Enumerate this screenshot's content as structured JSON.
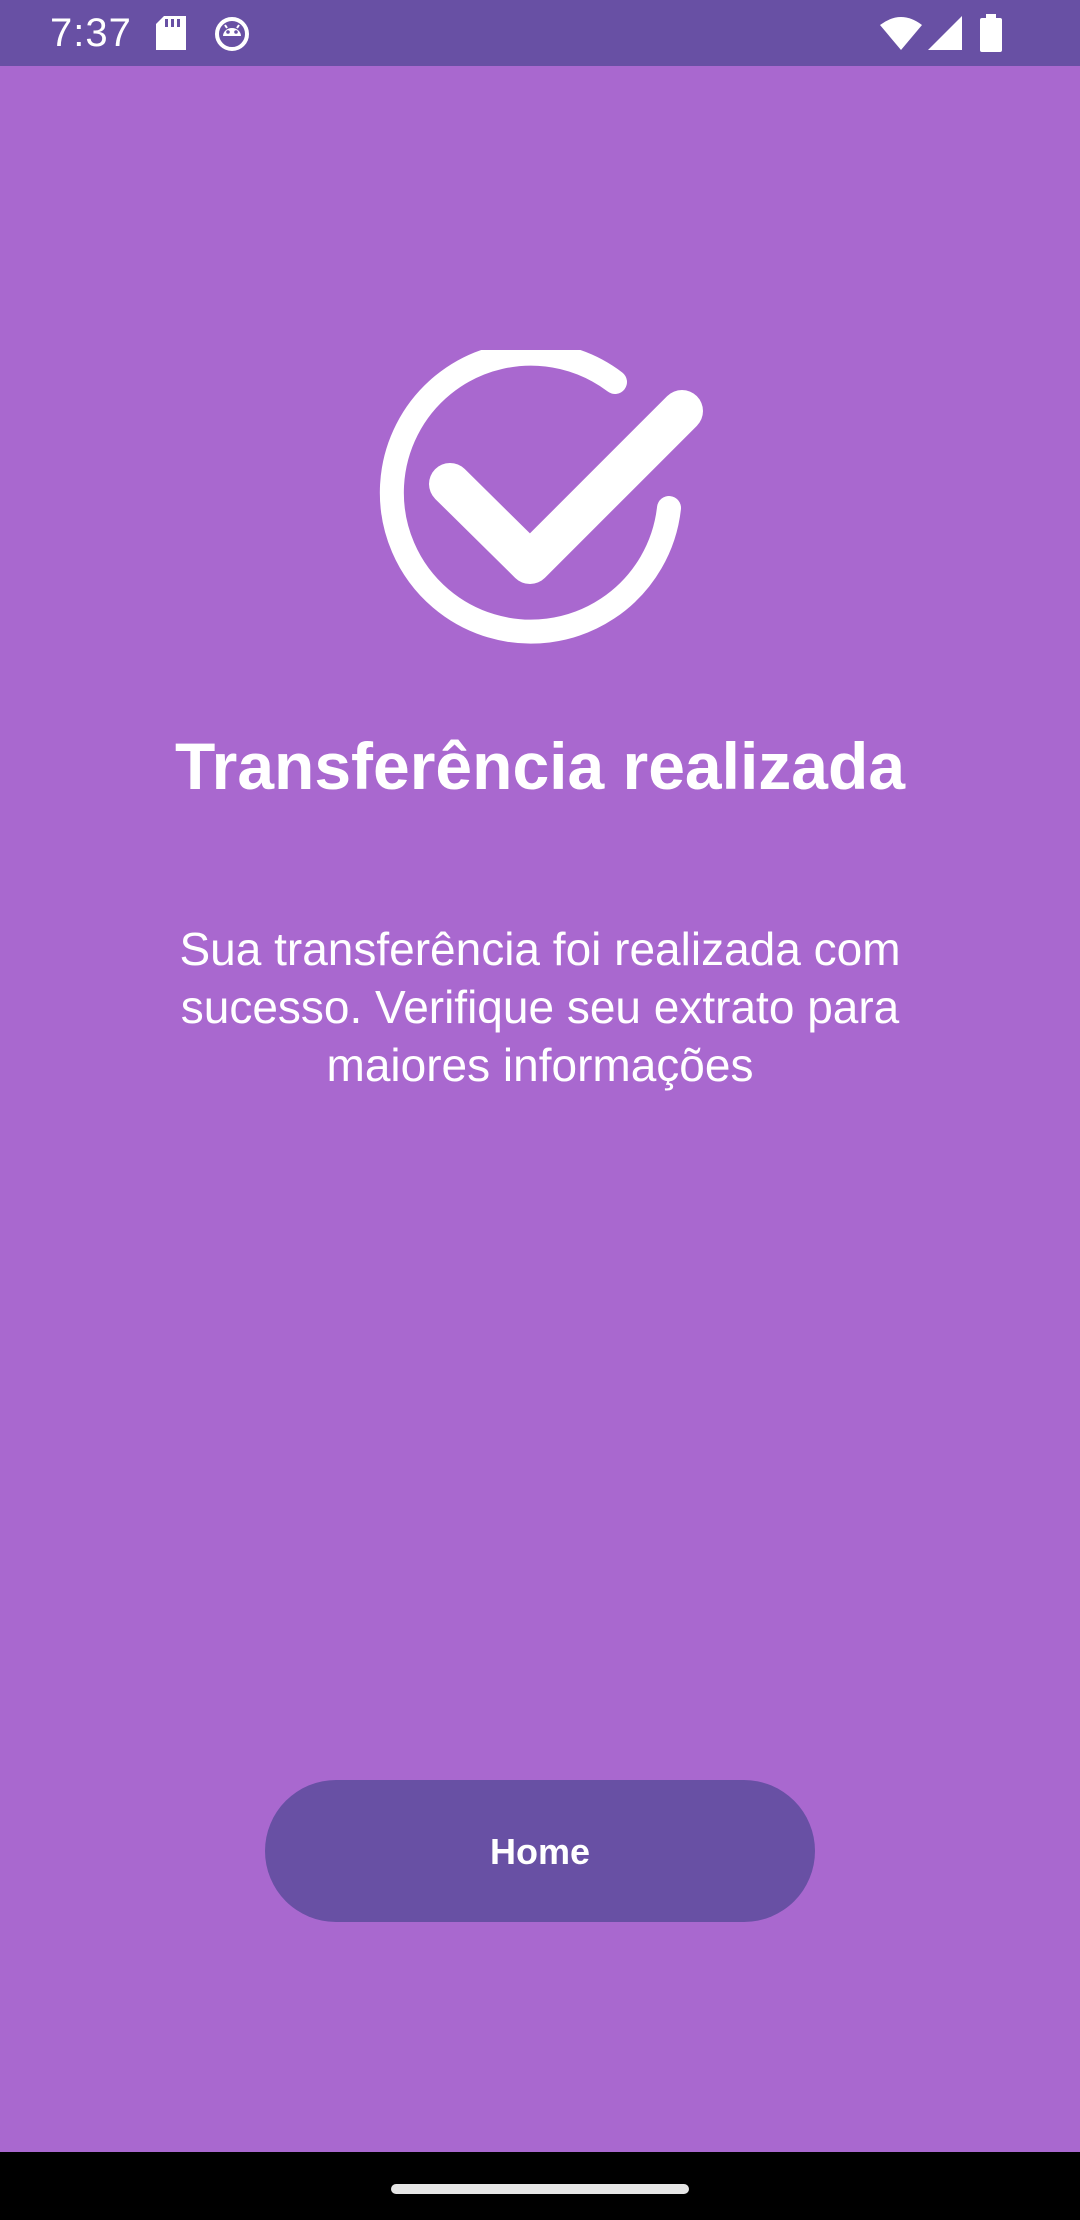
{
  "status_bar": {
    "time": "7:37",
    "left_icons": [
      "sd-card-icon",
      "android-debug-icon"
    ],
    "right_icons": [
      "wifi-icon",
      "signal-icon",
      "battery-icon"
    ]
  },
  "result": {
    "icon": "check-circle-icon",
    "title": "Transferência realizada",
    "message": "Sua transferência foi realizada com sucesso. Verifique seu extrato para maiores informações"
  },
  "actions": {
    "home_label": "Home"
  },
  "colors": {
    "background": "#a968cf",
    "status_bar": "#6850a4",
    "button": "#6850a4",
    "text": "#ffffff",
    "nav_bar": "#000000"
  }
}
